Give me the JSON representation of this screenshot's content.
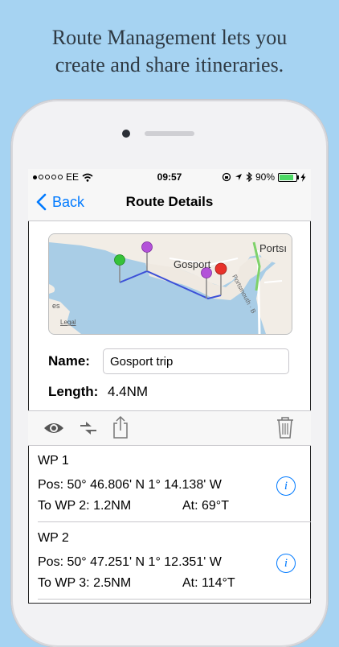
{
  "headline": {
    "line1": "Route Management lets you",
    "line2": "create and share itineraries."
  },
  "status_bar": {
    "carrier": "EE",
    "time": "09:57",
    "battery": "90%"
  },
  "nav": {
    "back_label": "Back",
    "title": "Route Details"
  },
  "map": {
    "labels": {
      "town1": "Gosport",
      "town2": "Portsı",
      "road": "Portsmouth · B",
      "legal": "Legal",
      "edge": "es"
    },
    "colors": {
      "land": "#f2ede6",
      "water": "#a9cde6",
      "route": "#3c50d8",
      "pin_green": "#36c23a",
      "pin_purple": "#b352d9",
      "pin_red": "#e8322b"
    }
  },
  "form": {
    "name_label": "Name:",
    "name_value": "Gosport trip",
    "length_label": "Length:",
    "length_value": "4.4NM"
  },
  "toolbar": {
    "icons": [
      "eye-icon",
      "swap-arrows-icon",
      "share-icon",
      "trash-icon"
    ]
  },
  "waypoints": [
    {
      "name": "WP 1",
      "pos": "Pos: 50° 46.806' N 1° 14.138' W",
      "to": "To WP 2: 1.2NM",
      "at": "At: 69°T"
    },
    {
      "name": "WP 2",
      "pos": "Pos: 50° 47.251' N 1° 12.351' W",
      "to": "To WP 3: 2.5NM",
      "at": "At: 114°T"
    }
  ],
  "info_glyph": "i",
  "accent_color": "#007aff"
}
